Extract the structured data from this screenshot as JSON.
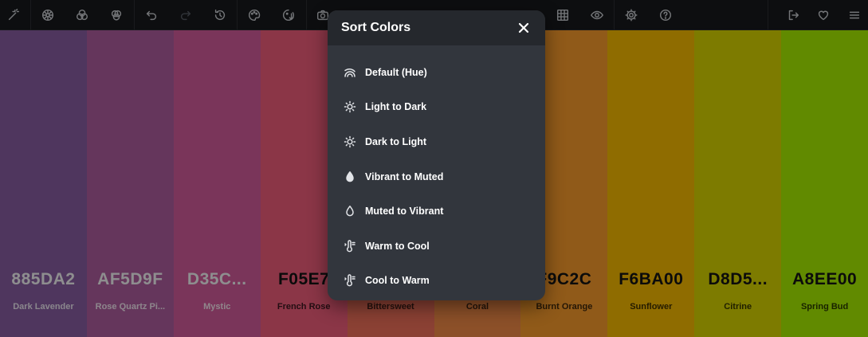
{
  "toolbar": {
    "left_icons": [
      {
        "name": "magic-wand-icon",
        "enabled": true
      },
      {
        "name": "color-wheel-icon",
        "enabled": true
      },
      {
        "name": "color-blend-icon",
        "enabled": true
      },
      {
        "name": "color-mix-icon",
        "enabled": true
      },
      {
        "name": "undo-icon",
        "enabled": true
      },
      {
        "name": "redo-icon",
        "enabled": false
      },
      {
        "name": "history-icon",
        "enabled": true
      },
      {
        "name": "palette-icon",
        "enabled": true
      },
      {
        "name": "sort-icon",
        "enabled": true
      },
      {
        "name": "camera-icon",
        "enabled": true
      },
      {
        "name": "grid-icon",
        "enabled": true
      },
      {
        "name": "eye-icon",
        "enabled": true
      },
      {
        "name": "settings-icon",
        "enabled": true
      },
      {
        "name": "help-icon",
        "enabled": true
      }
    ],
    "right_icons": [
      {
        "name": "export-icon"
      },
      {
        "name": "heart-icon"
      },
      {
        "name": "menu-icon"
      }
    ]
  },
  "palette": [
    {
      "hex": "885DA2",
      "name": "Dark Lavender",
      "color": "#885DA2",
      "text": "light"
    },
    {
      "hex": "AF5D9F",
      "name": "Rose Quartz Pi...",
      "color": "#AF5D9F",
      "text": "light"
    },
    {
      "hex": "D35C...",
      "name": "Mystic",
      "color": "#D35C9B",
      "text": "light"
    },
    {
      "hex": "F05E7",
      "name": "French Rose",
      "color": "#F05E7B",
      "text": "dark"
    },
    {
      "hex": "",
      "name": "Bittersweet",
      "color": "#F0705A",
      "text": "dark"
    },
    {
      "hex": "",
      "name": "Coral",
      "color": "#F28A48",
      "text": "dark"
    },
    {
      "hex": "F9C2C",
      "name": "Burnt Orange",
      "color": "#F99C2C",
      "text": "dark"
    },
    {
      "hex": "F6BA00",
      "name": "Sunflower",
      "color": "#F6BA00",
      "text": "dark"
    },
    {
      "hex": "D8D5...",
      "name": "Citrine",
      "color": "#D8D500",
      "text": "dark"
    },
    {
      "hex": "A8EE00",
      "name": "Spring Bud",
      "color": "#A8EE00",
      "text": "dark"
    }
  ],
  "sort_modal": {
    "title": "Sort Colors",
    "options": [
      {
        "label": "Default (Hue)",
        "icon": "rainbow-icon"
      },
      {
        "label": "Light to Dark",
        "icon": "sun-icon"
      },
      {
        "label": "Dark to Light",
        "icon": "sun-icon"
      },
      {
        "label": "Vibrant to Muted",
        "icon": "drop-filled-icon"
      },
      {
        "label": "Muted to Vibrant",
        "icon": "drop-outline-icon"
      },
      {
        "label": "Warm to Cool",
        "icon": "temperature-icon"
      },
      {
        "label": "Cool to Warm",
        "icon": "temperature-icon"
      }
    ]
  }
}
